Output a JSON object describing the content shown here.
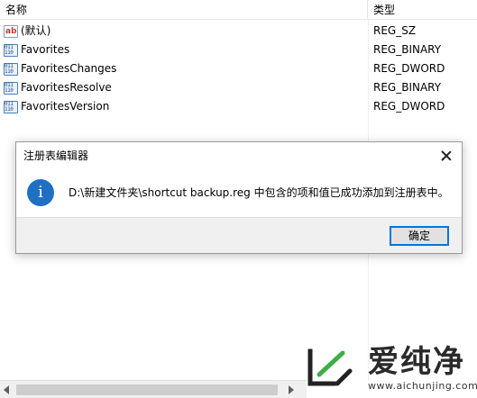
{
  "columns": {
    "name": "名称",
    "type": "类型"
  },
  "rows": [
    {
      "icon": "string-value-icon",
      "icon_glyph": "ab",
      "name": "(默认)",
      "type": "REG_SZ"
    },
    {
      "icon": "binary-value-icon",
      "icon_glyph": "011\n110",
      "name": "Favorites",
      "type": "REG_BINARY"
    },
    {
      "icon": "binary-value-icon",
      "icon_glyph": "011\n110",
      "name": "FavoritesChanges",
      "type": "REG_DWORD"
    },
    {
      "icon": "binary-value-icon",
      "icon_glyph": "011\n110",
      "name": "FavoritesResolve",
      "type": "REG_BINARY"
    },
    {
      "icon": "binary-value-icon",
      "icon_glyph": "011\n110",
      "name": "FavoritesVersion",
      "type": "REG_DWORD"
    }
  ],
  "dialog": {
    "title": "注册表编辑器",
    "icon": "info-icon",
    "icon_glyph": "i",
    "message": "D:\\新建文件夹\\shortcut backup.reg 中包含的项和值已成功添加到注册表中。",
    "ok_label": "确定",
    "accent_color": "#0078d7"
  },
  "watermark": {
    "text": "爱纯净",
    "url": "www.aichunjing.com",
    "color": "#2a2a2a"
  }
}
